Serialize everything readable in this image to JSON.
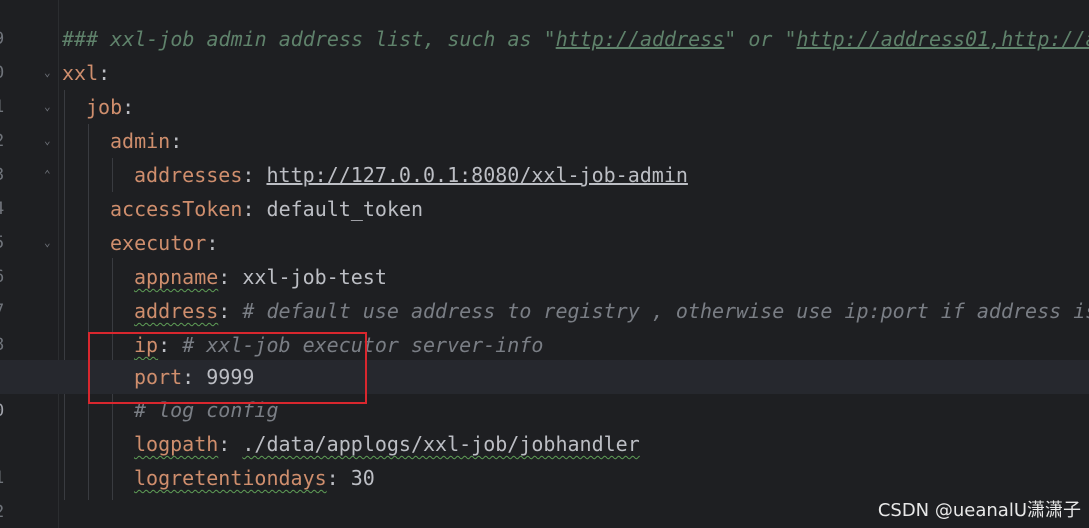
{
  "editor": {
    "line_numbers": [
      "9",
      "0",
      "1",
      "2",
      "3",
      "4",
      "5",
      "6",
      "7",
      "8",
      "9",
      "0",
      "1",
      "2"
    ],
    "lines": {
      "l0": {
        "comment": "### xxl-job admin address list, such as \"",
        "url1": "http://address",
        "mid": "\" or \"",
        "url2": "http://address01,http://a"
      },
      "l1": {
        "key": "xxl",
        "colon": ":"
      },
      "l2": {
        "key": "job",
        "colon": ":"
      },
      "l3": {
        "key": "admin",
        "colon": ":"
      },
      "l4": {
        "key": "addresses",
        "colon": ": ",
        "value": "http://127.0.0.1:8080/xxl-job-admin"
      },
      "l5": {
        "key": "accessToken",
        "colon": ": ",
        "value": "default_token"
      },
      "l6": {
        "key": "executor",
        "colon": ":"
      },
      "l7": {
        "key": "appname",
        "colon": ": ",
        "value": "xxl-job-test"
      },
      "l8": {
        "key": "address",
        "colon": ": ",
        "comment": "# default use address to registry , otherwise use ip:port if address is"
      },
      "l9": {
        "key": "ip",
        "colon": ": ",
        "comment": "# xxl-job executor server-info"
      },
      "l10": {
        "key": "port",
        "colon": ": ",
        "value": "9999"
      },
      "l11": {
        "comment": "# log config"
      },
      "l12": {
        "key": "logpath",
        "colon": ": ",
        "value": "./data/applogs/xxl-job/jobhandler"
      },
      "l13": {
        "key": "logretentiondays",
        "colon": ": ",
        "value": "30"
      }
    }
  },
  "watermark": "CSDN @ueanalU潇潇子",
  "colors": {
    "key": "#cf8e6d",
    "comment": "#7a7e85",
    "highlight_box": "#d9272e"
  }
}
